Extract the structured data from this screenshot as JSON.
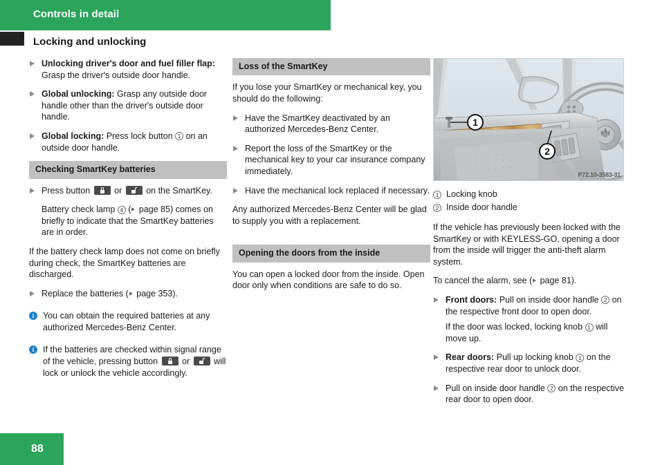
{
  "header": {
    "chapter_title": "Controls in detail",
    "page_heading": "Locking and unlocking",
    "bar_color": "#2ba45c",
    "tab_color": "#222222"
  },
  "footer": {
    "page_number": "88"
  },
  "column_left": {
    "bullets": [
      {
        "lead": "Unlocking driver's door and fuel filler flap:",
        "text": " Grasp the driver's outside door handle."
      },
      {
        "lead": "Global unlocking:",
        "text": " Grasp any outside door handle other than the driver's outside door handle."
      },
      {
        "lead": "Global locking:",
        "text_before": " Press lock button ",
        "ref": "1",
        "text_after": " on an outside door handle."
      }
    ],
    "section": {
      "heading": "Checking SmartKey batteries",
      "bullet_press": {
        "text_1": "Press button ",
        "icon_lock": "lock-closed-button-icon",
        "text_2": " or ",
        "icon_unlock": "lock-open-button-icon",
        "text_3": " on the SmartKey."
      },
      "sub_text_1": "Battery check lamp ",
      "sub_ref": "4",
      "sub_text_2": " (",
      "sub_page_ref": " page 85) comes on briefly to indicate that the SmartKey batteries are in order.",
      "para_discharged": "If the battery check lamp does not come on briefly during check, the SmartKey batteries are discharged.",
      "bullet_replace_1": "Replace the batteries (",
      "bullet_replace_2": " page 353).",
      "note_1": "You can obtain the required batteries at any authorized Mercedes-Benz Center.",
      "note_2_text_1": "If the batteries are checked within signal range of the vehicle, pressing button ",
      "note_2_text_2": " or ",
      "note_2_text_3": " will lock or unlock the vehicle accordingly."
    }
  },
  "column_middle": {
    "section_loss": {
      "heading": "Loss of the SmartKey",
      "intro": "If you lose your SmartKey or mechanical key, you should do the following:",
      "bullets": [
        "Have the SmartKey deactivated by an authorized Mercedes-Benz Center.",
        "Report the loss of the SmartKey or the mechanical key to your car insurance company immediately.",
        "Have the mechanical lock replaced if necessary."
      ],
      "closing": "Any authorized Mercedes-Benz Center will be glad to supply you with a replacement."
    },
    "section_opening": {
      "heading": "Opening the doors from the inside",
      "para": "You can open a locked door from the inside. Open door only when conditions are safe to do so."
    }
  },
  "column_right": {
    "figure": {
      "code": "P72.10-3583-31",
      "callout_1": "1",
      "callout_2": "2",
      "alt": "car-door-interior-illustration"
    },
    "legend": [
      {
        "num": "1",
        "label": "Locking knob"
      },
      {
        "num": "2",
        "label": "Inside door handle"
      }
    ],
    "para_alarm": "If the vehicle has previously been locked with the SmartKey or with KEYLESS-GO, opening a door from the inside will trigger the anti-theft alarm system.",
    "para_cancel_1": "To cancel the alarm, see (",
    "para_cancel_2": " page 81).",
    "bullets": [
      {
        "lead": "Front doors:",
        "text_before": " Pull on inside door handle ",
        "ref": "2",
        "text_after": " on the respective front door to open door."
      },
      {
        "lead": "Rear doors:",
        "text_before": " Pull up locking knob ",
        "ref": "1",
        "text_after": " on the respective rear door to unlock door."
      },
      {
        "lead": "",
        "text_before": "Pull on inside door handle ",
        "ref": "2",
        "text_after": " on the respective rear door to open door."
      }
    ],
    "sub_front": {
      "text_before": "If the door was locked, locking knob ",
      "ref": "1",
      "text_after": " will move up."
    }
  }
}
